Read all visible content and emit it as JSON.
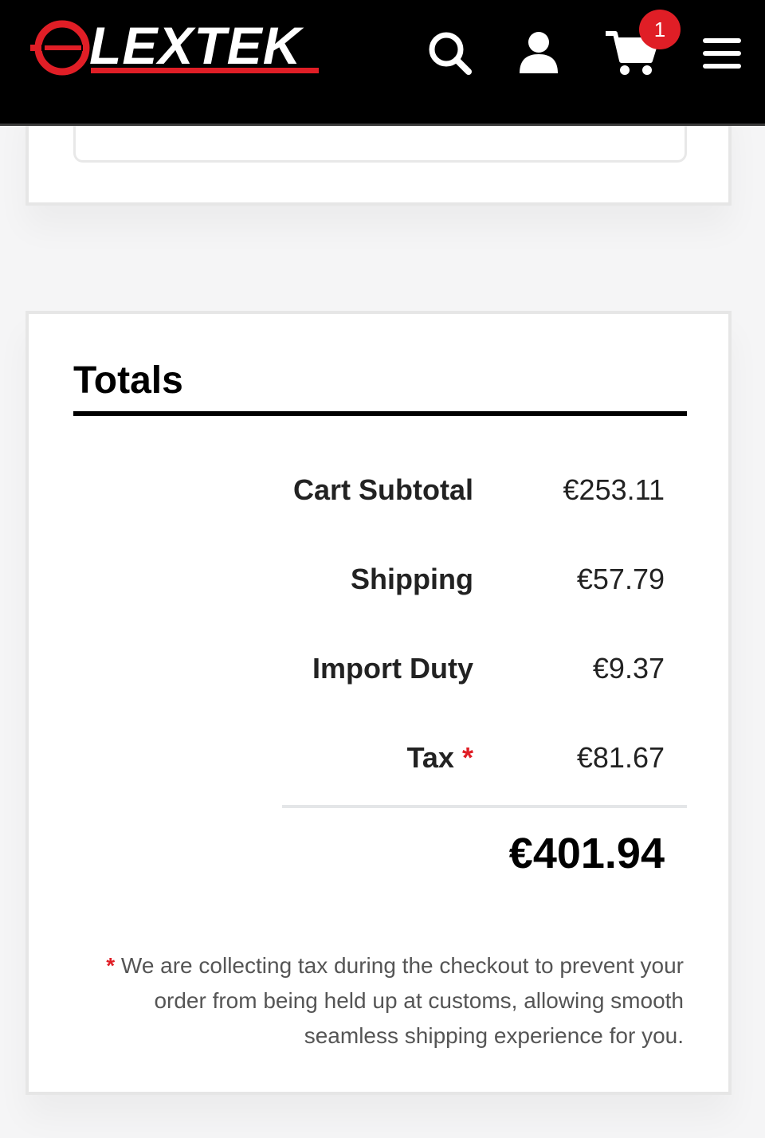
{
  "header": {
    "logo_text": "LEXTEK",
    "icons": [
      "search-icon",
      "user-icon",
      "cart-icon",
      "menu-icon"
    ],
    "cart_count": "1",
    "colors": {
      "bar": "#000000",
      "brand_red": "#e01e26"
    }
  },
  "totals": {
    "title": "Totals",
    "rows": [
      {
        "label": "Cart Subtotal",
        "value": "€253.11"
      },
      {
        "label": "Shipping",
        "value": "€57.79"
      },
      {
        "label": "Import Duty",
        "value": "€9.37"
      },
      {
        "label": "Tax",
        "marker": "*",
        "value": "€81.67"
      }
    ],
    "grand_total": "€401.94",
    "note_marker": "*",
    "note_text": "We are collecting tax during the checkout to prevent your order from being held up at customs, allowing smooth seamless shipping experience for you."
  }
}
